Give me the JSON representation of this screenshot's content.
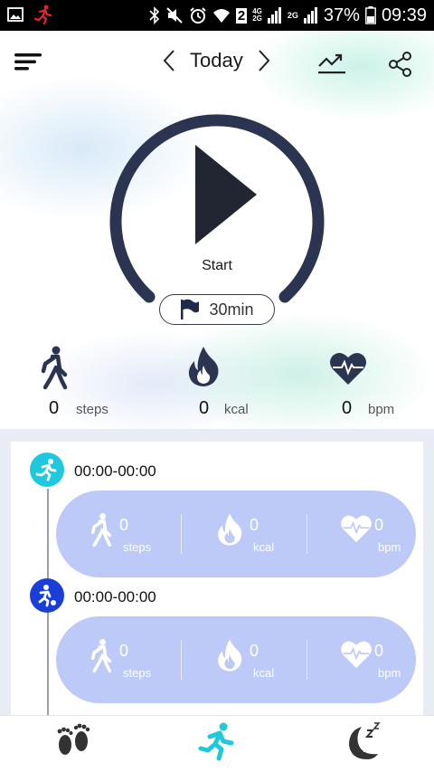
{
  "status_bar": {
    "battery": "37%",
    "time": "09:39",
    "sim": "2",
    "net1": "4G",
    "net2": "2G",
    "net3": "2G"
  },
  "header": {
    "date_label": "Today"
  },
  "workout": {
    "start_label": "Start",
    "goal_label": "30min"
  },
  "summary": {
    "steps": {
      "value": "0",
      "unit": "steps"
    },
    "kcal": {
      "value": "0",
      "unit": "kcal"
    },
    "bpm": {
      "value": "0",
      "unit": "bpm"
    }
  },
  "activities": [
    {
      "time": "00:00-00:00",
      "steps": "0",
      "steps_unit": "steps",
      "kcal": "0",
      "kcal_unit": "kcal",
      "bpm": "0",
      "bpm_unit": "bpm"
    },
    {
      "time": "00:00-00:00",
      "steps": "0",
      "steps_unit": "steps",
      "kcal": "0",
      "kcal_unit": "kcal",
      "bpm": "0",
      "bpm_unit": "bpm"
    }
  ],
  "colors": {
    "ring": "#2b3450",
    "accent_cyan": "#1fc8dc",
    "accent_blue": "#1a3fd6",
    "pill": "#bdcaf7"
  },
  "icons": [
    "menu-icon",
    "chevron-left-icon",
    "chevron-right-icon",
    "trend-icon",
    "share-icon",
    "play-icon",
    "flag-icon",
    "walk-icon",
    "flame-icon",
    "heart-pulse-icon",
    "run-icon",
    "soccer-icon",
    "footprints-icon",
    "sleep-icon"
  ]
}
